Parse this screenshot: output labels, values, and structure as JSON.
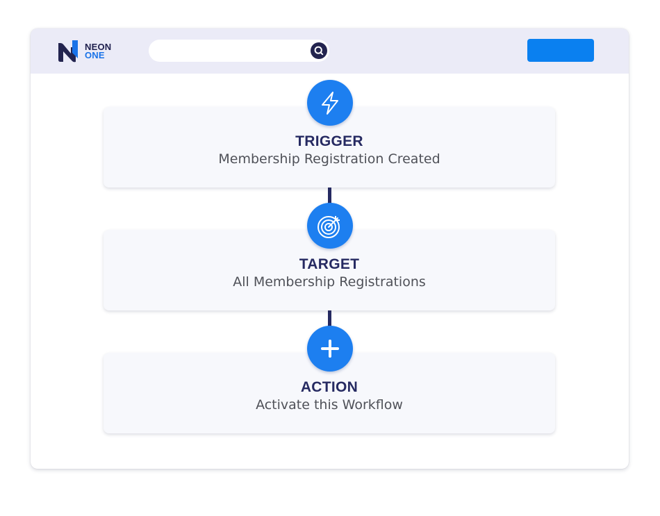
{
  "header": {
    "logo": {
      "line1": "NEON",
      "line2": "ONE"
    },
    "search": {
      "placeholder": "",
      "icon": "search-icon"
    },
    "button_label": ""
  },
  "steps": [
    {
      "title": "TRIGGER",
      "subtitle": "Membership Registration Created",
      "icon": "lightning-bolt-icon"
    },
    {
      "title": "TARGET",
      "subtitle": "All Membership Registrations",
      "icon": "target-icon"
    },
    {
      "title": "ACTION",
      "subtitle": "Activate this Workflow",
      "icon": "plus-icon"
    }
  ],
  "colors": {
    "topbar_bg": "#ebebf7",
    "accent_blue": "#1d7ff0",
    "button_blue": "#0a80f0",
    "navy": "#262a62",
    "card_bg": "#f7f8fc",
    "subtitle_gray": "#4f5158"
  }
}
